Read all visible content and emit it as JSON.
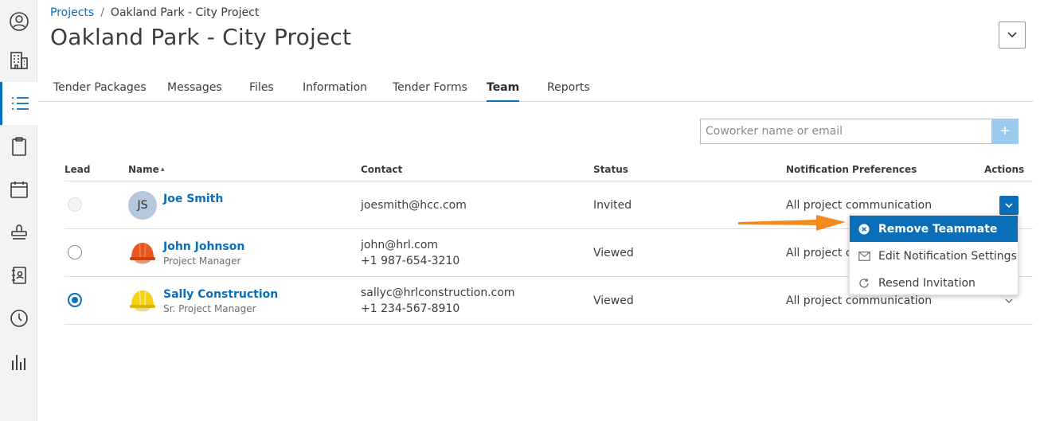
{
  "colors": {
    "accent": "#0a6fb8",
    "add_button": "#9dcbee",
    "arrow": "#f28a1e",
    "avatar_initials_bg": "#b7c7dc"
  },
  "sidebar": {
    "items": [
      {
        "icon": "user-circle-icon"
      },
      {
        "icon": "building-icon"
      },
      {
        "icon": "list-icon",
        "active": true
      },
      {
        "icon": "clipboard-icon"
      },
      {
        "icon": "calendar-icon"
      },
      {
        "icon": "stamp-icon"
      },
      {
        "icon": "address-book-icon"
      },
      {
        "icon": "clock-icon"
      },
      {
        "icon": "bar-chart-icon"
      }
    ]
  },
  "breadcrumb": {
    "link": "Projects",
    "separator": "/",
    "current": "Oakland Park - City Project"
  },
  "page": {
    "title": "Oakland Park - City Project"
  },
  "tabs": [
    {
      "label": "Tender Packages"
    },
    {
      "label": "Messages"
    },
    {
      "label": "Files"
    },
    {
      "label": "Information"
    },
    {
      "label": "Tender Forms"
    },
    {
      "label": "Team",
      "active": true
    },
    {
      "label": "Reports"
    }
  ],
  "coworker": {
    "placeholder": "Coworker name or email",
    "add_label": "+"
  },
  "table": {
    "headers": {
      "lead": "Lead",
      "name": "Name",
      "sort_indicator": "▴",
      "contact": "Contact",
      "status": "Status",
      "notifications": "Notification Preferences",
      "actions": "Actions"
    },
    "rows": [
      {
        "lead": "disabled",
        "avatar": {
          "type": "initials",
          "text": "JS"
        },
        "name": "Joe Smith",
        "subtitle": "",
        "contact": [
          "joesmith@hcc.com"
        ],
        "status": "Invited",
        "notifications": "All project communication"
      },
      {
        "lead": "unchecked",
        "avatar": {
          "type": "orange-hardhat-icon"
        },
        "name": "John Johnson",
        "subtitle": "Project Manager",
        "contact": [
          "john@hrl.com",
          "+1 987-654-3210"
        ],
        "status": "Viewed",
        "notifications": "All project c"
      },
      {
        "lead": "checked",
        "avatar": {
          "type": "yellow-hardhat-icon"
        },
        "name": "Sally Construction",
        "subtitle": "Sr. Project Manager",
        "contact": [
          "sallyc@hrlconstruction.com",
          "+1 234-567-8910"
        ],
        "status": "Viewed",
        "notifications": "All project communication"
      }
    ]
  },
  "actions_menu": {
    "items": [
      {
        "label": "Remove Teammate",
        "icon": "remove-circle-icon",
        "highlighted": true
      },
      {
        "label": "Edit Notification Settings",
        "icon": "envelope-icon"
      },
      {
        "label": "Resend Invitation",
        "icon": "refresh-icon"
      }
    ]
  }
}
